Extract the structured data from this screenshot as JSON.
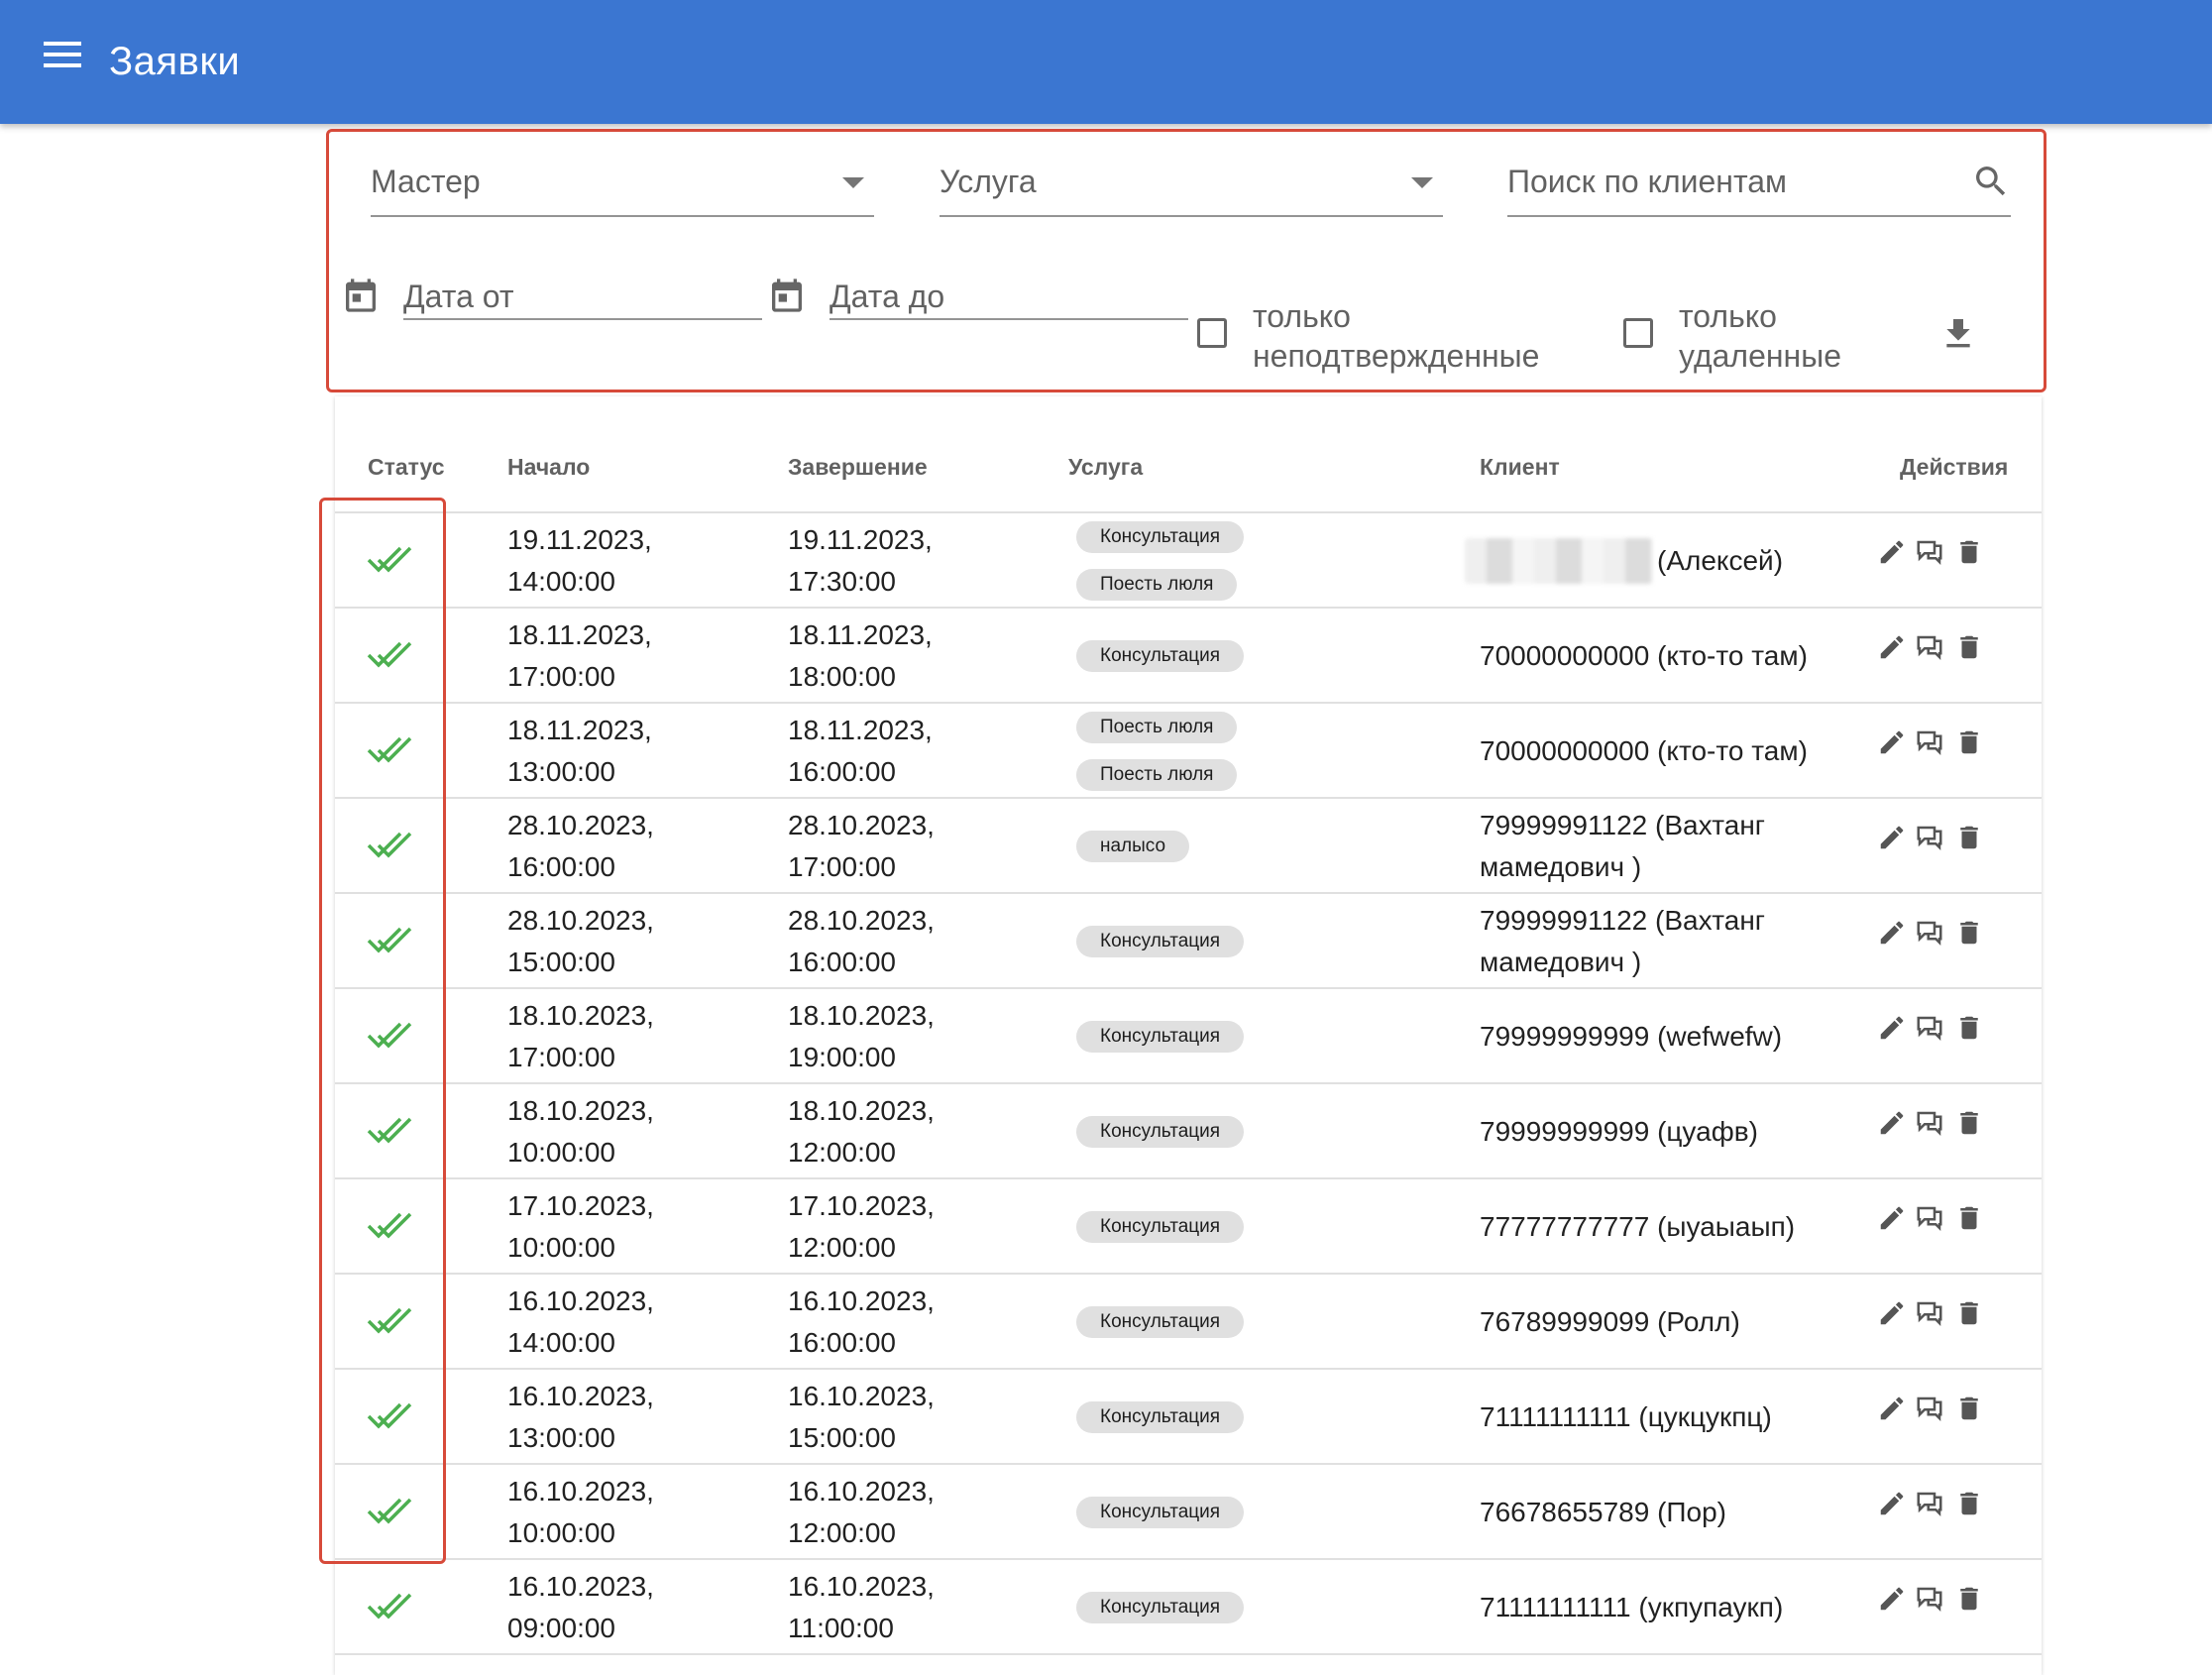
{
  "appbar": {
    "title": "Заявки",
    "menu_icon": "menu-icon",
    "color": "#3b76d1"
  },
  "filters": {
    "master_label": "Мастер",
    "service_label": "Услуга",
    "search_placeholder": "Поиск по клиентам",
    "date_from_label": "Дата от",
    "date_to_label": "Дата до",
    "only_unconfirmed_label": "только\nнеподтвержденные",
    "only_unconfirmed_checked": false,
    "only_deleted_label": "только\nудаленные",
    "only_deleted_checked": false,
    "highlight_color": "#d74a3a"
  },
  "table": {
    "headers": {
      "status": "Статус",
      "start": "Начало",
      "end": "Завершение",
      "service": "Услуга",
      "client": "Клиент",
      "actions": "Действия"
    },
    "status_color": "#4caf50",
    "rows": [
      {
        "start": "19.11.2023,\n14:00:00",
        "end": "19.11.2023,\n17:30:00",
        "services": [
          "Консультация",
          "Поесть люля"
        ],
        "client": "(Алексей)",
        "client_redacted": true
      },
      {
        "start": "18.11.2023,\n17:00:00",
        "end": "18.11.2023,\n18:00:00",
        "services": [
          "Консультация"
        ],
        "client": "70000000000 (кто-то там)"
      },
      {
        "start": "18.11.2023,\n13:00:00",
        "end": "18.11.2023,\n16:00:00",
        "services": [
          "Поесть люля",
          "Поесть люля"
        ],
        "client": "70000000000 (кто-то там)"
      },
      {
        "start": "28.10.2023,\n16:00:00",
        "end": "28.10.2023,\n17:00:00",
        "services": [
          "налысо"
        ],
        "client": "79999991122 (Вахтанг мамедович )"
      },
      {
        "start": "28.10.2023,\n15:00:00",
        "end": "28.10.2023,\n16:00:00",
        "services": [
          "Консультация"
        ],
        "client": "79999991122 (Вахтанг мамедович )"
      },
      {
        "start": "18.10.2023,\n17:00:00",
        "end": "18.10.2023,\n19:00:00",
        "services": [
          "Консультация"
        ],
        "client": "79999999999 (wefwefw)"
      },
      {
        "start": "18.10.2023,\n10:00:00",
        "end": "18.10.2023,\n12:00:00",
        "services": [
          "Консультация"
        ],
        "client": "79999999999 (цуафв)"
      },
      {
        "start": "17.10.2023,\n10:00:00",
        "end": "17.10.2023,\n12:00:00",
        "services": [
          "Консультация"
        ],
        "client": "77777777777 (ыуаыаып)"
      },
      {
        "start": "16.10.2023,\n14:00:00",
        "end": "16.10.2023,\n16:00:00",
        "services": [
          "Консультация"
        ],
        "client": "76789999099 (Ролл)"
      },
      {
        "start": "16.10.2023,\n13:00:00",
        "end": "16.10.2023,\n15:00:00",
        "services": [
          "Консультация"
        ],
        "client": "71111111111 (цукцукпц)"
      },
      {
        "start": "16.10.2023,\n10:00:00",
        "end": "16.10.2023,\n12:00:00",
        "services": [
          "Консультация"
        ],
        "client": "76678655789 (Пор)"
      },
      {
        "start": "16.10.2023,\n09:00:00",
        "end": "16.10.2023,\n11:00:00",
        "services": [
          "Консультация"
        ],
        "client": "71111111111 (укпупаукп)"
      }
    ]
  }
}
